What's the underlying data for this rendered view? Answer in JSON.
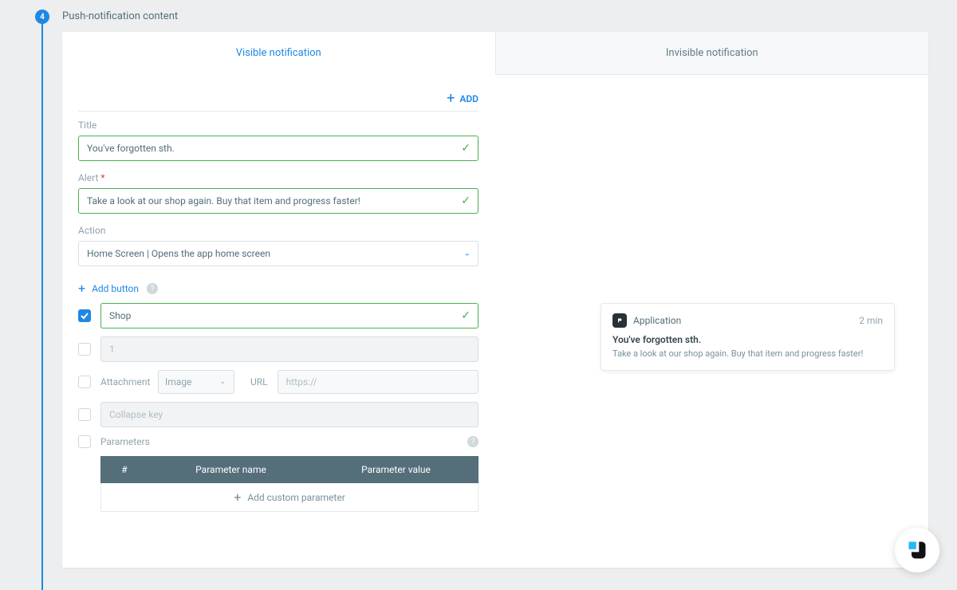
{
  "step": {
    "number": "4",
    "title": "Push-notification content"
  },
  "tabs": {
    "visible": "Visible notification",
    "invisible": "Invisible notification"
  },
  "add_label": "ADD",
  "fields": {
    "title_label": "Title",
    "title_value": "You've forgotten sth.",
    "alert_label": "Alert",
    "alert_value": "Take a look at our shop again. Buy that item and progress faster!",
    "action_label": "Action",
    "action_value": "Home Screen | Opens the app home screen"
  },
  "add_button_label": "Add button",
  "button_rows": {
    "row1_value": "Shop",
    "row2_placeholder": "1"
  },
  "attachment": {
    "label": "Attachment",
    "type": "Image",
    "url_label": "URL",
    "url_placeholder": "https://"
  },
  "collapse_placeholder": "Collapse key",
  "parameters_label": "Parameters",
  "table": {
    "hash": "#",
    "name": "Parameter name",
    "value": "Parameter value",
    "add": "Add custom parameter"
  },
  "preview": {
    "app": "Application",
    "time": "2 min",
    "title": "You've forgotten sth.",
    "body": "Take a look at our shop again. Buy that item and progress faster!"
  }
}
